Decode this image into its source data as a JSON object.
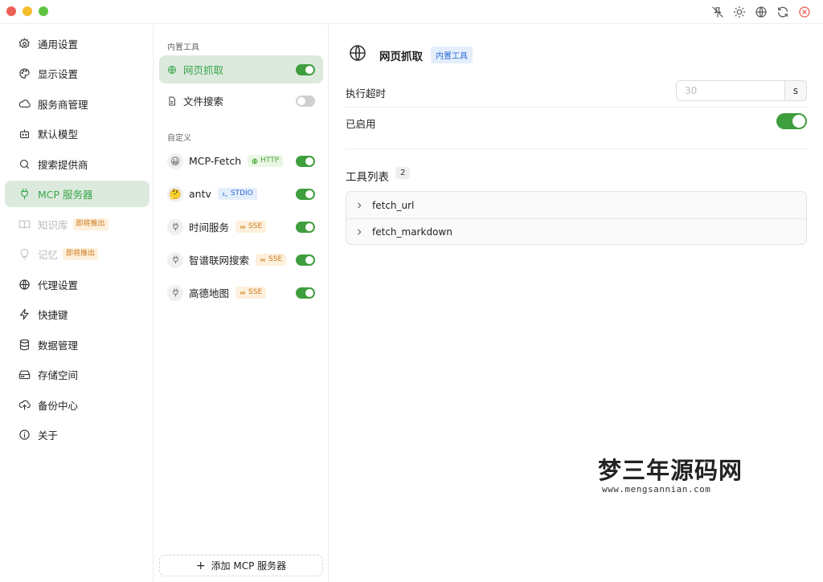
{
  "titlebar": {
    "icons": [
      "pin-off-icon",
      "sun-icon",
      "globe-icon",
      "refresh-icon",
      "close-circle-icon"
    ]
  },
  "sidebar": {
    "items": [
      {
        "label": "通用设置",
        "icon": "gear-icon"
      },
      {
        "label": "显示设置",
        "icon": "palette-icon"
      },
      {
        "label": "服务商管理",
        "icon": "cloud-icon"
      },
      {
        "label": "默认模型",
        "icon": "robot-icon"
      },
      {
        "label": "搜索提供商",
        "icon": "search-icon"
      },
      {
        "label": "MCP 服务器",
        "icon": "plug-icon",
        "active": true
      },
      {
        "label": "知识库",
        "icon": "book-icon",
        "badge": "即将推出",
        "disabled": true
      },
      {
        "label": "记忆",
        "icon": "bulb-icon",
        "badge": "即将推出",
        "disabled": true
      },
      {
        "label": "代理设置",
        "icon": "globe-icon"
      },
      {
        "label": "快捷键",
        "icon": "lightning-icon"
      },
      {
        "label": "数据管理",
        "icon": "database-icon"
      },
      {
        "label": "存储空间",
        "icon": "hard-drive-icon"
      },
      {
        "label": "备份中心",
        "icon": "cloud-upload-icon"
      },
      {
        "label": "关于",
        "icon": "info-icon"
      }
    ]
  },
  "servers": {
    "builtin_label": "内置工具",
    "custom_label": "自定义",
    "builtin": [
      {
        "name": "网页抓取",
        "icon": "globe-icon",
        "enabled": true,
        "active": true
      },
      {
        "name": "文件搜索",
        "icon": "file-icon",
        "enabled": false
      }
    ],
    "custom": [
      {
        "name": "MCP-Fetch",
        "avatar": "😀",
        "tag": "HTTP",
        "tag_type": "http",
        "enabled": true
      },
      {
        "name": "antv",
        "avatar": "🤔",
        "tag": "STDIO",
        "tag_type": "stdio",
        "enabled": true
      },
      {
        "name": "时间服务",
        "avatar_icon": "plug-icon",
        "tag": "SSE",
        "tag_type": "sse",
        "enabled": true
      },
      {
        "name": "智谱联网搜索",
        "avatar_icon": "plug-icon",
        "tag": "SSE",
        "tag_type": "sse",
        "enabled": true
      },
      {
        "name": "高德地图",
        "avatar_icon": "plug-icon",
        "tag": "SSE",
        "tag_type": "sse",
        "enabled": true
      }
    ],
    "add_label": "添加 MCP 服务器"
  },
  "detail": {
    "title": "网页抓取",
    "badge": "内置工具",
    "timeout_label": "执行超时",
    "timeout_placeholder": "30",
    "timeout_unit": "s",
    "enabled_label": "已启用",
    "enabled": true,
    "tools_title": "工具列表",
    "tools_count": "2",
    "tools": [
      "fetch_url",
      "fetch_markdown"
    ]
  },
  "watermark": {
    "title": "梦三年源码网",
    "url": "www.mengsannian.com"
  }
}
